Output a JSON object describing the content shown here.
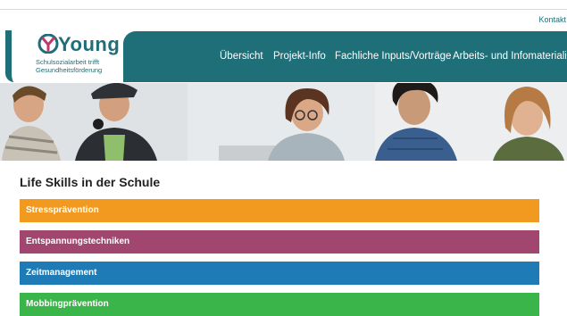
{
  "header": {
    "kontakt_label": "Kontakt",
    "logo": {
      "name": "Young",
      "tagline_line1": "Schulsozialarbeit trifft",
      "tagline_line2": "Gesundheitsförderung"
    },
    "nav": [
      {
        "label": "Übersicht"
      },
      {
        "label": "Projekt-Info"
      },
      {
        "label": "Fachliche Inputs/Vorträge"
      },
      {
        "label": "Arbeits- und Infomaterialien"
      }
    ],
    "brand_color": "#1f6f79"
  },
  "main": {
    "section_title": "Life Skills in der Schule",
    "accordion": [
      {
        "label": "Stressprävention",
        "color": "#f29a1f"
      },
      {
        "label": "Entspannungstechniken",
        "color": "#a1466e"
      },
      {
        "label": "Zeitmanagement",
        "color": "#1f7bb5"
      },
      {
        "label": "Mobbingprävention",
        "color": "#3ab54a"
      }
    ]
  }
}
